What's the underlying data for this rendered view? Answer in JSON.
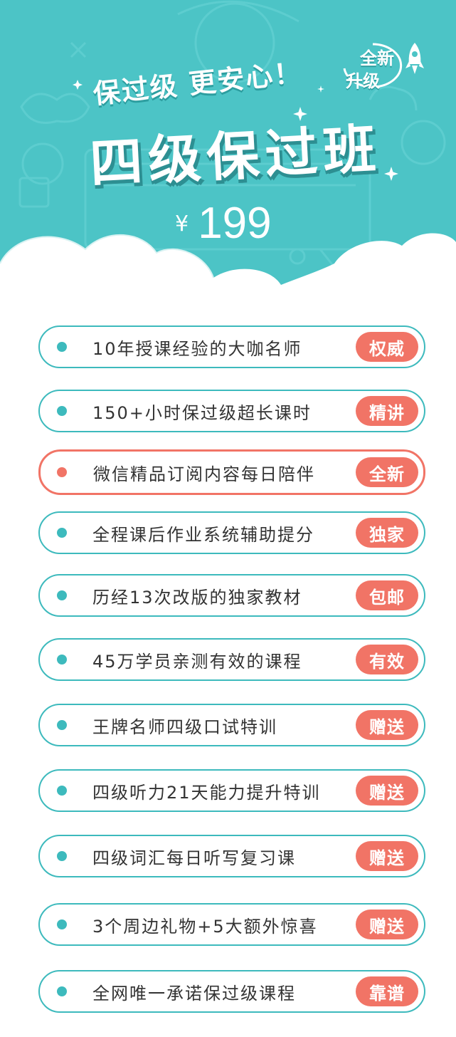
{
  "hero": {
    "slogan": "保过级 更安心！",
    "badge_line1": "全新",
    "badge_line2": "升级",
    "title": "四级保过班",
    "currency": "¥",
    "price": "199"
  },
  "colors": {
    "hero_bg": "#4cc4c6",
    "accent_teal": "#3dbabd",
    "accent_coral": "#f17466",
    "text": "#333333"
  },
  "features": [
    {
      "text": "10年授课经验的大咖名师",
      "tag": "权威",
      "highlight": false
    },
    {
      "text": "150+小时保过级超长课时",
      "tag": "精讲",
      "highlight": false
    },
    {
      "text": "微信精品订阅内容每日陪伴",
      "tag": "全新",
      "highlight": true
    },
    {
      "text": "全程课后作业系统辅助提分",
      "tag": "独家",
      "highlight": false
    },
    {
      "text": "历经13次改版的独家教材",
      "tag": "包邮",
      "highlight": false
    },
    {
      "text": "45万学员亲测有效的课程",
      "tag": "有效",
      "highlight": false
    },
    {
      "text": "王牌名师四级口试特训",
      "tag": "赠送",
      "highlight": false
    },
    {
      "text": "四级听力21天能力提升特训",
      "tag": "赠送",
      "highlight": false
    },
    {
      "text": "四级词汇每日听写复习课",
      "tag": "赠送",
      "highlight": false
    },
    {
      "text": "3个周边礼物+5大额外惊喜",
      "tag": "赠送",
      "highlight": false
    },
    {
      "text": "全网唯一承诺保过级课程",
      "tag": "靠谱",
      "highlight": false
    }
  ]
}
